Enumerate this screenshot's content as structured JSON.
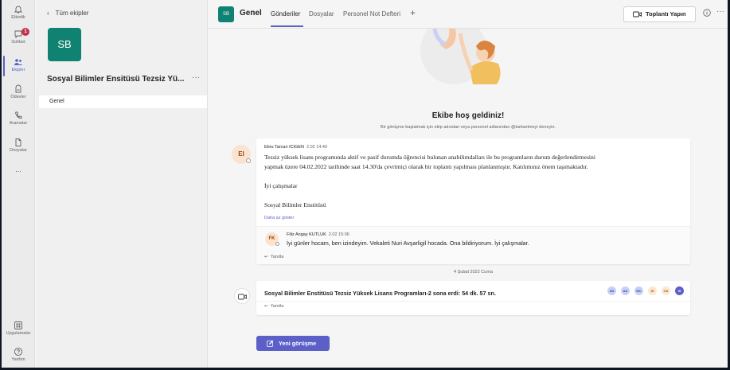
{
  "rail": {
    "items": [
      {
        "label": "Etkinlik"
      },
      {
        "label": "Sohbet",
        "badge": "1"
      },
      {
        "label": "Ekipler"
      },
      {
        "label": "Ödevler"
      },
      {
        "label": "Aramalar"
      },
      {
        "label": "Dosyalar"
      },
      {
        "label": "..."
      }
    ],
    "bottom": [
      {
        "label": "Uygulamalar"
      },
      {
        "label": "Yardım"
      }
    ],
    "accent": "#5b5fc7"
  },
  "team_panel": {
    "back_label": "Tüm ekipler",
    "avatar_initials": "SB",
    "team_name": "Sosyal Bilimler Ensitüsü Tezsiz Yü...",
    "more": "···",
    "channels": [
      {
        "label": "Genel"
      }
    ]
  },
  "header": {
    "avatar_initials": "SB",
    "title": "Genel",
    "tabs": [
      {
        "label": "Gönderiler"
      },
      {
        "label": "Dosyalar"
      },
      {
        "label": "Personel Not Defteri"
      }
    ],
    "add_tab": "+",
    "meet_label": "Toplantı Yapın",
    "more": "···"
  },
  "welcome": {
    "title": "Ekibe hoş geldiniz!",
    "subtitle": "Bir görüşme başlatmak için ekip adından veya personel adlarından @bahsetmeyi deneyin."
  },
  "post": {
    "avatar": "EI",
    "author": "Ebru Tarcan ICIGEN",
    "time": "2.02 14:40",
    "body_lines": [
      "Tezsiz yüksek lisans programında aktif ve pasif durumda öğrencisi bulunan anabilimdalları ile bu programların durum değerlendirmesini",
      "yapmak üzere 04.02.2022 tarihinde saat 14.30'da çevrimiçi  olarak bir toplantı yapılması planlanmıştır. Katılımınız önem taşımaktadır.",
      "İyi çalışmalar",
      "Sosyal Bilimler Enstitüsü"
    ],
    "show_less": "Daha az göster",
    "reply": {
      "avatar": "FK",
      "author": "Filiz Angay KUTLUK",
      "time": "2.02 15:06",
      "body": "İyi günler hocam, ben izindeyim. Vekaleti Nuri Avşarligil hocada. Ona bildiriyorum. İyi çalışmalar."
    },
    "reply_label": "Yanıtla"
  },
  "date_separator": "4 Şubat 2022 Cuma",
  "meeting": {
    "title": "Sosyal Bilimler Enstitüsü Tezsiz Yüksek Lisans Programları-2 sona erdi: 54 dk. 57 sn.",
    "attendees": [
      {
        "initials": "AD",
        "bg": "#c7d1f7",
        "fg": "#3a4a9c"
      },
      {
        "initials": "AA",
        "bg": "#c7d1f7",
        "fg": "#3a4a9c"
      },
      {
        "initials": "MC",
        "bg": "#c7d1f7",
        "fg": "#3a4a9c"
      },
      {
        "initials": "SI",
        "bg": "#fde7d3",
        "fg": "#a35a1e"
      },
      {
        "initials": "OA",
        "bg": "#fde7d3",
        "fg": "#a35a1e"
      },
      {
        "initials": "IS",
        "bg": "#5b5fc7",
        "fg": "#ffffff"
      }
    ],
    "reply_label": "Yanıtla"
  },
  "new_conversation": "Yeni görüşme"
}
